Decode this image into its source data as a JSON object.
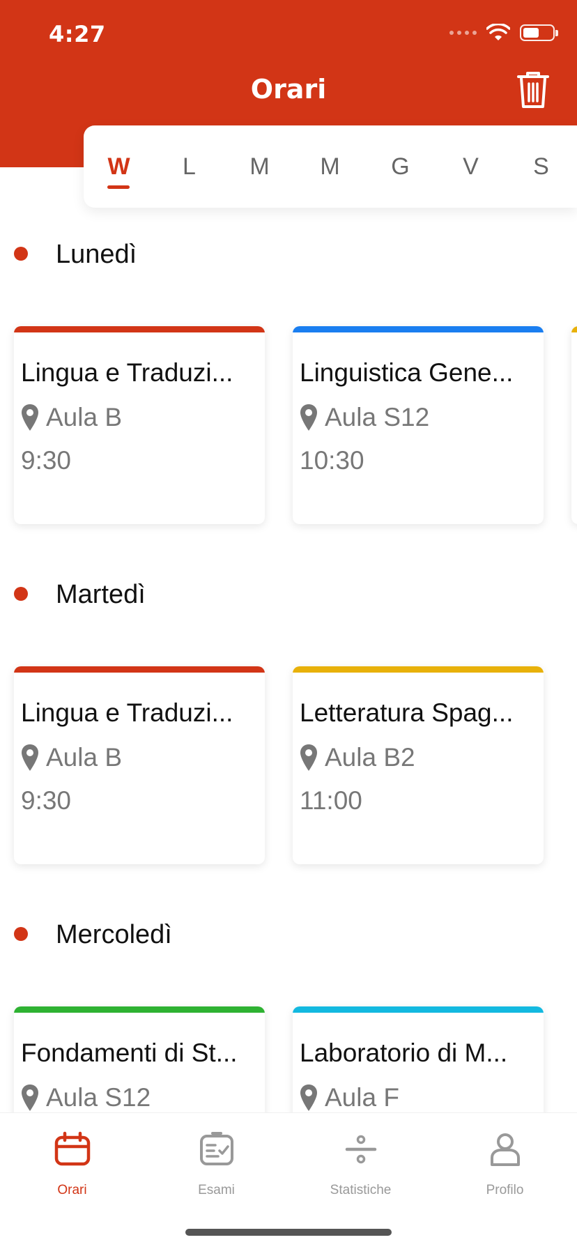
{
  "status_bar": {
    "time": "4:27",
    "battery_level": 0.55
  },
  "header": {
    "title": "Orari",
    "trash_icon": "trash-icon"
  },
  "day_tabs": [
    {
      "label": "W",
      "active": true
    },
    {
      "label": "L",
      "active": false
    },
    {
      "label": "M",
      "active": false
    },
    {
      "label": "M",
      "active": false
    },
    {
      "label": "G",
      "active": false
    },
    {
      "label": "V",
      "active": false
    },
    {
      "label": "S",
      "active": false
    }
  ],
  "days": [
    {
      "name": "Lunedì",
      "lessons": [
        {
          "course": "Lingua e Traduzi...",
          "room": "Aula B",
          "time": "9:30",
          "color": "#d23516"
        },
        {
          "course": "Linguistica Gene...",
          "room": "Aula S12",
          "time": "10:30",
          "color": "#1a7ef0"
        }
      ],
      "peek_color": "#e8b10a"
    },
    {
      "name": "Martedì",
      "lessons": [
        {
          "course": "Lingua e Traduzi...",
          "room": "Aula B",
          "time": "9:30",
          "color": "#d23516"
        },
        {
          "course": "Letteratura Spag...",
          "room": "Aula B2",
          "time": "11:00",
          "color": "#e8b10a"
        }
      ]
    },
    {
      "name": "Mercoledì",
      "lessons": [
        {
          "course": "Fondamenti di St...",
          "room": "Aula S12",
          "time": "",
          "color": "#2eb232"
        },
        {
          "course": "Laboratorio di M...",
          "room": "Aula F",
          "time": "",
          "color": "#13b9e0"
        }
      ]
    }
  ],
  "tabbar": {
    "tabs": [
      {
        "label": "Orari",
        "icon": "calendar-icon",
        "active": true
      },
      {
        "label": "Esami",
        "icon": "clipboard-check-icon",
        "active": false
      },
      {
        "label": "Statistiche",
        "icon": "divide-icon",
        "active": false
      },
      {
        "label": "Profilo",
        "icon": "user-icon",
        "active": false
      }
    ]
  },
  "colors": {
    "accent": "#d23516",
    "inactive": "#999999"
  }
}
